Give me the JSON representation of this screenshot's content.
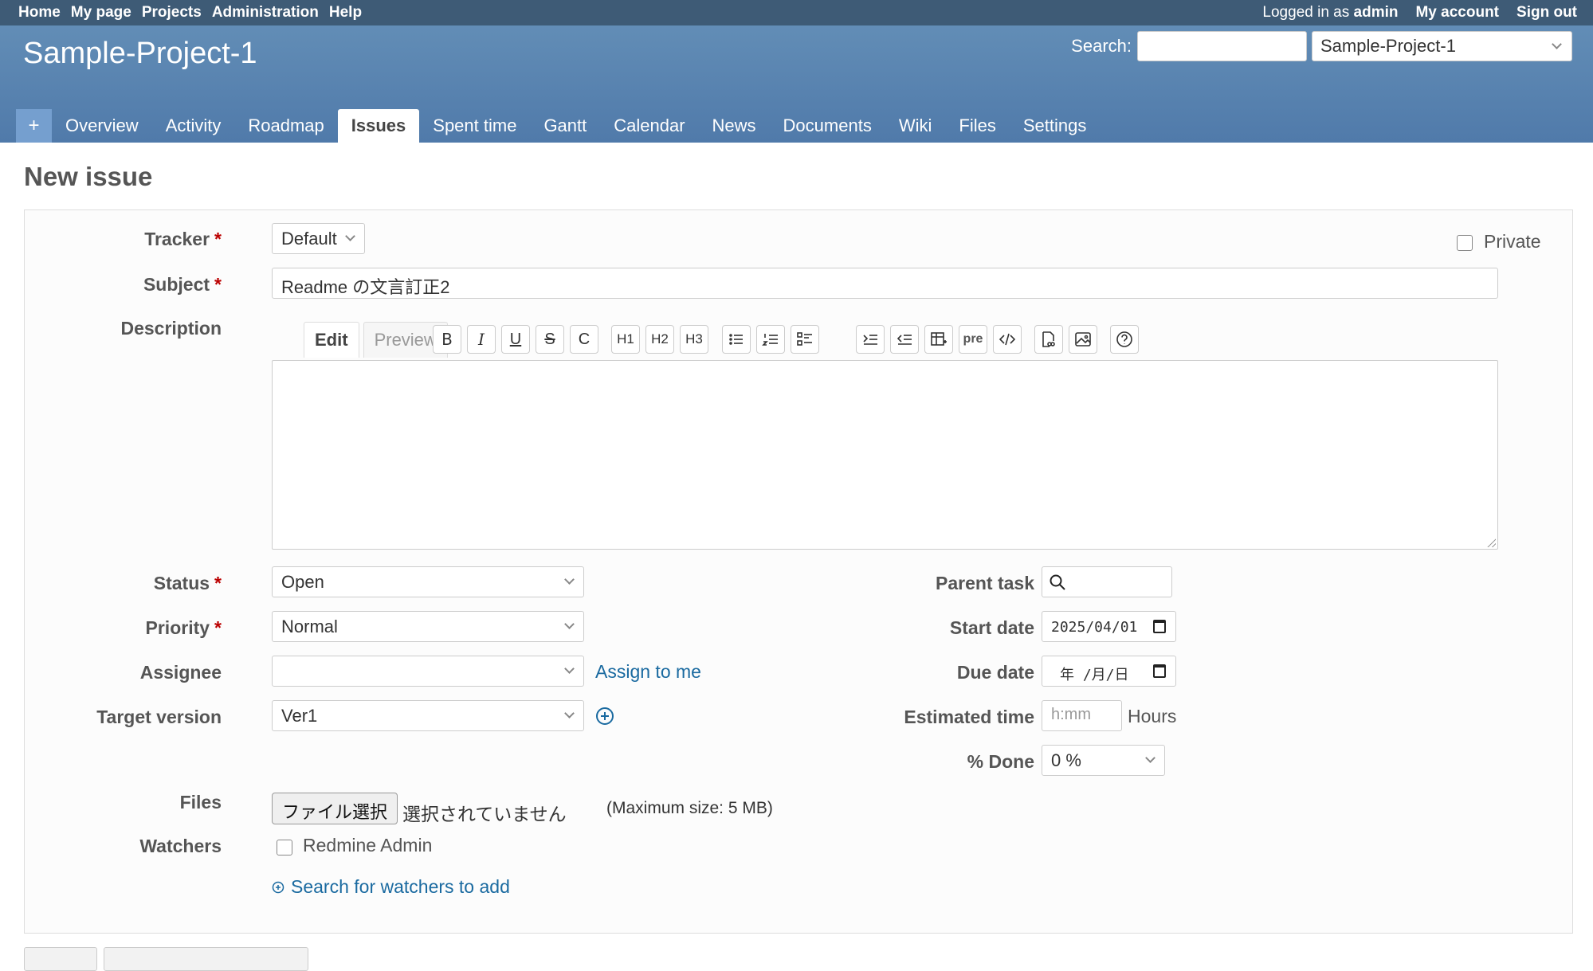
{
  "topmenu": {
    "items": [
      "Home",
      "My page",
      "Projects",
      "Administration",
      "Help"
    ],
    "logged_prefix": "Logged in as",
    "user": "admin",
    "my_account": "My account",
    "sign_out": "Sign out"
  },
  "header": {
    "project_title": "Sample-Project-1",
    "search_label": "Search:",
    "search_value": "",
    "project_jump": "Sample-Project-1"
  },
  "main_menu": {
    "new_label": "+",
    "tabs": [
      "Overview",
      "Activity",
      "Roadmap",
      "Issues",
      "Spent time",
      "Gantt",
      "Calendar",
      "News",
      "Documents",
      "Wiki",
      "Files",
      "Settings"
    ],
    "selected": "Issues"
  },
  "page_title": "New issue",
  "form": {
    "tracker_label": "Tracker",
    "tracker_value": "Default",
    "required_mark": "*",
    "private_label": "Private",
    "subject_label": "Subject",
    "subject_value": "Readme の文言訂正2",
    "description_label": "Description",
    "edit_tab": "Edit",
    "preview_tab": "Preview",
    "toolbar": {
      "bold": "B",
      "italic": "I",
      "underline": "U",
      "strike": "S",
      "code": "C",
      "h1": "H1",
      "h2": "H2",
      "h3": "H3",
      "pre": "pre",
      "icons": [
        "bold-icon",
        "italic-icon",
        "underline-icon",
        "strikethrough-icon",
        "inline-code-icon",
        "heading-1-icon",
        "heading-2-icon",
        "heading-3-icon",
        "unordered-list-icon",
        "ordered-list-icon",
        "task-list-icon",
        "indent-icon",
        "outdent-icon",
        "table-icon",
        "preformatted-icon",
        "code-highlight-icon",
        "wiki-link-icon",
        "image-icon",
        "help-icon"
      ]
    },
    "description_value": "",
    "status_label": "Status",
    "status_value": "Open",
    "priority_label": "Priority",
    "priority_value": "Normal",
    "assignee_label": "Assignee",
    "assignee_value": "",
    "assign_to_me": "Assign to me",
    "target_version_label": "Target version",
    "target_version_value": "Ver1",
    "parent_task_label": "Parent task",
    "parent_task_value": "",
    "start_date_label": "Start date",
    "start_date_value": "2025/04/01",
    "due_date_label": "Due date",
    "due_date_value": "年 /月/日",
    "estimated_time_label": "Estimated time",
    "estimated_time_placeholder": "h:mm",
    "hours_label": "Hours",
    "done_label": "% Done",
    "done_value": "0 %",
    "files_label": "Files",
    "choose_file": "ファイル選択",
    "no_file": "選択されていません",
    "max_size": "(Maximum size: 5 MB)",
    "watchers_label": "Watchers",
    "watcher_name": "Redmine Admin",
    "search_watchers": "Search for watchers to add"
  },
  "colors": {
    "topmenu_bg": "#3e5b76",
    "header_bg": "#628db6",
    "link": "#1a6aa0",
    "required": "#bb0000"
  }
}
